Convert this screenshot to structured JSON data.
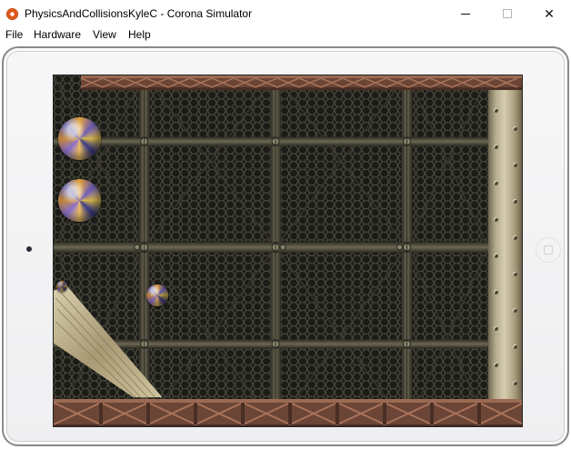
{
  "window": {
    "title": "PhysicsAndCollisionsKyleC - Corona Simulator",
    "minimize_glyph": "",
    "close_glyph": "✕"
  },
  "menu": {
    "items": [
      {
        "label": "File"
      },
      {
        "label": "Hardware"
      },
      {
        "label": "View"
      },
      {
        "label": "Help"
      }
    ]
  },
  "device": {
    "type": "tablet",
    "orientation": "landscape"
  },
  "game": {
    "scene": "metal grate arena",
    "balls_visible": 4,
    "colors": {
      "grate": "#2b2b26",
      "girder": "#7a4e3a",
      "pillar": "#b3a98b",
      "ramp": "#c8bb98"
    }
  }
}
